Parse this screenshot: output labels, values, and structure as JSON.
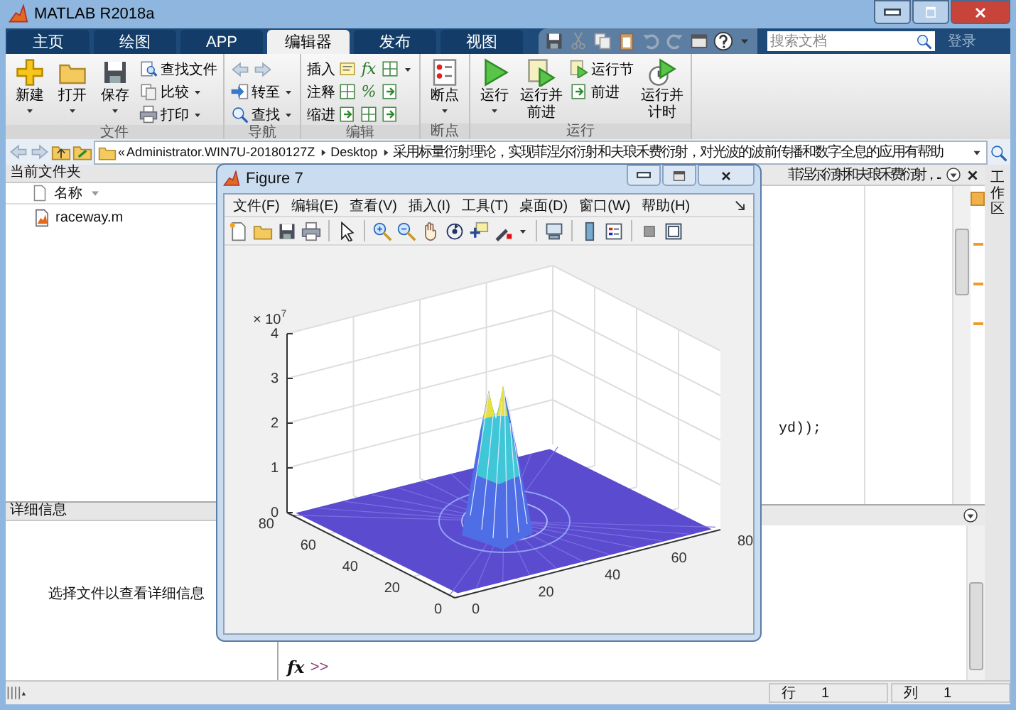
{
  "window": {
    "title": "MATLAB R2018a"
  },
  "tabs": [
    {
      "label": "主页",
      "selected": false
    },
    {
      "label": "绘图",
      "selected": false
    },
    {
      "label": "APP",
      "selected": false
    },
    {
      "label": "编辑器",
      "selected": true
    },
    {
      "label": "发布",
      "selected": false
    },
    {
      "label": "视图",
      "selected": false
    }
  ],
  "search": {
    "placeholder": "搜索文档"
  },
  "sign_in": "登录",
  "ribbon": {
    "groups": [
      {
        "label": "文件",
        "columns": [
          {
            "kind": "large",
            "lines": [
              "新建"
            ],
            "dropdown": true
          },
          {
            "kind": "large",
            "lines": [
              "打开"
            ],
            "dropdown": true
          },
          {
            "kind": "large",
            "lines": [
              "保存"
            ],
            "dropdown": true
          },
          {
            "kind": "stack",
            "rows": [
              {
                "kind": "button",
                "label": "查找文件",
                "dropdown": false
              },
              {
                "kind": "button",
                "label": "比较",
                "dropdown": true
              },
              {
                "kind": "button",
                "label": "打印",
                "dropdown": true
              }
            ]
          }
        ]
      },
      {
        "label": "导航",
        "columns": [
          {
            "kind": "stack",
            "rows": [
              {
                "kind": "arrows"
              },
              {
                "kind": "button",
                "label": "转至",
                "dropdown": true
              },
              {
                "kind": "button",
                "label": "查找",
                "dropdown": true
              }
            ]
          }
        ]
      },
      {
        "label": "编辑",
        "columns": [
          {
            "kind": "stack",
            "rows": [
              {
                "kind": "edit",
                "label": "插入",
                "glyph": "fx",
                "dropdown": true
              },
              {
                "kind": "edit",
                "label": "注释",
                "glyph": "%",
                "dropdown": false
              },
              {
                "kind": "edit",
                "label": "缩进",
                "dropdown": false
              }
            ]
          }
        ]
      },
      {
        "label": "断点",
        "columns": [
          {
            "kind": "large",
            "lines": [
              "断点"
            ],
            "dropdown": true
          }
        ]
      },
      {
        "label": "运行",
        "columns": [
          {
            "kind": "large",
            "lines": [
              "运行"
            ],
            "dropdown": true
          },
          {
            "kind": "large",
            "lines": [
              "运行并",
              "前进"
            ],
            "dropdown": false
          },
          {
            "kind": "stack",
            "rows": [
              {
                "kind": "button",
                "label": "运行节",
                "dropdown": false
              },
              {
                "kind": "button",
                "label": "前进",
                "dropdown": false
              }
            ]
          },
          {
            "kind": "large",
            "lines": [
              "运行并",
              "计时"
            ],
            "dropdown": false
          }
        ]
      }
    ]
  },
  "address": {
    "overflow": "«",
    "segments": [
      "Administrator.WIN7U-20180127Z",
      "Desktop",
      "采用标量衍射理论，实现菲涅尔衍射和夫琅禾费衍射，对光波的波前传播和数字全息的应用有帮助"
    ]
  },
  "current_folder": {
    "title": "当前文件夹",
    "column": "名称",
    "files": [
      {
        "name": "raceway.m"
      }
    ]
  },
  "details": {
    "title": "详细信息",
    "message": "选择文件以查看详细信息"
  },
  "editor": {
    "tab_title": "菲涅尔衍射和夫琅禾费衍射，...",
    "code_line": "yd));"
  },
  "command_window": {
    "prompt_icon": "fx",
    "prompt": ">>"
  },
  "workspace_tab": "工作区",
  "figure": {
    "title": "Figure 7",
    "menu": [
      "文件(F)",
      "编辑(E)",
      "查看(V)",
      "插入(I)",
      "工具(T)",
      "桌面(D)",
      "窗口(W)",
      "帮助(H)"
    ],
    "plot": {
      "exponent": {
        "base": "× 10",
        "power": "7"
      },
      "z_ticks": [
        "4",
        "3",
        "2",
        "1",
        "0"
      ],
      "y_ticks": [
        "0",
        "20",
        "40",
        "60",
        "80"
      ],
      "x_ticks": [
        "0",
        "20",
        "40",
        "60",
        "80"
      ]
    }
  },
  "status_bar": {
    "fields": [
      {
        "label": "行",
        "value": "1"
      },
      {
        "label": "列",
        "value": "1"
      }
    ]
  }
}
